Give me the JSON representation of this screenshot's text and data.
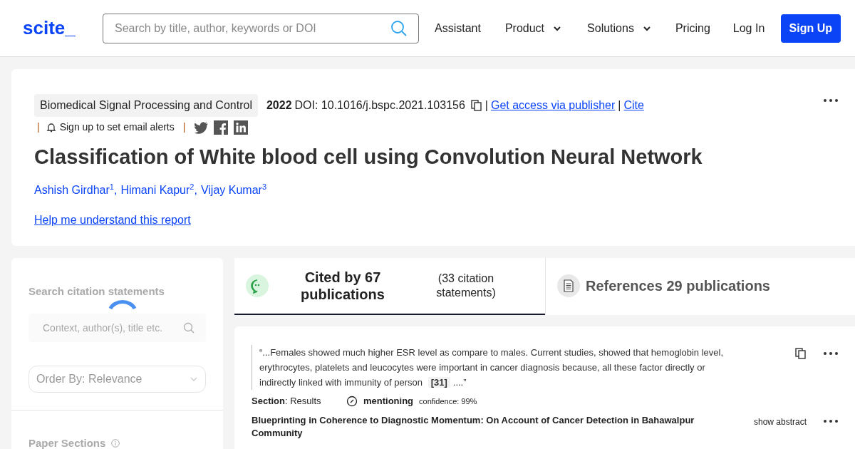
{
  "header": {
    "logo": "scite_",
    "search": {
      "placeholder": "Search by title, author, keywords or DOI"
    },
    "nav": [
      {
        "label": "Assistant",
        "dropdown": false
      },
      {
        "label": "Product",
        "dropdown": true
      },
      {
        "label": "Solutions",
        "dropdown": true
      },
      {
        "label": "Pricing",
        "dropdown": false
      },
      {
        "label": "Log In",
        "dropdown": false
      }
    ],
    "signup": "Sign Up"
  },
  "separator": "|",
  "paper": {
    "journal": "Biomedical Signal Processing and Control",
    "year": "2022",
    "doi": "DOI: 10.1016/j.bspc.2021.103156",
    "access_link": "Get access via publisher",
    "cite_link": "Cite",
    "alerts": "Sign up to set email alerts",
    "title": "Classification of White blood cell using Convolution Neural Network",
    "authors": [
      "Ashish Girdhar$^{1}$,",
      "Himani Kapur$^{2}$,",
      "Vijay Kumar$^{3}$"
    ],
    "help_link": "Help me understand this report"
  },
  "sidebar": {
    "search_label": "Search citation statements",
    "search_placeholder": "Context, author(s), title etc.",
    "order_by": "Order By: Relevance",
    "sections_label": "Paper Sections"
  },
  "tabs": [
    {
      "kind": "cited",
      "title": "Cited by 67 publications",
      "note": "(33 citation statements)",
      "selected": true
    },
    {
      "kind": "references",
      "title": "References 29 publications",
      "selected": false
    }
  ],
  "citation": {
    "quote_before": "“...Females showed much higher ESR level as compare to males. Current studies, showed that hemoglobin level, erythrocytes, platelets and leucocytes were important in cancer diagnosis because, all these factor directly or indirectly linked with immunity of person",
    "ref": "[31]",
    "quote_after": "....”",
    "section": "**Section**: Results",
    "type": "mentioning",
    "confidence": "confidence: 99%",
    "title": "Blueprinting in Coherence to Diagnostic Momentum: On Account of Cancer Detection in Bahawalpur Community",
    "show_abstract": "show abstract"
  }
}
